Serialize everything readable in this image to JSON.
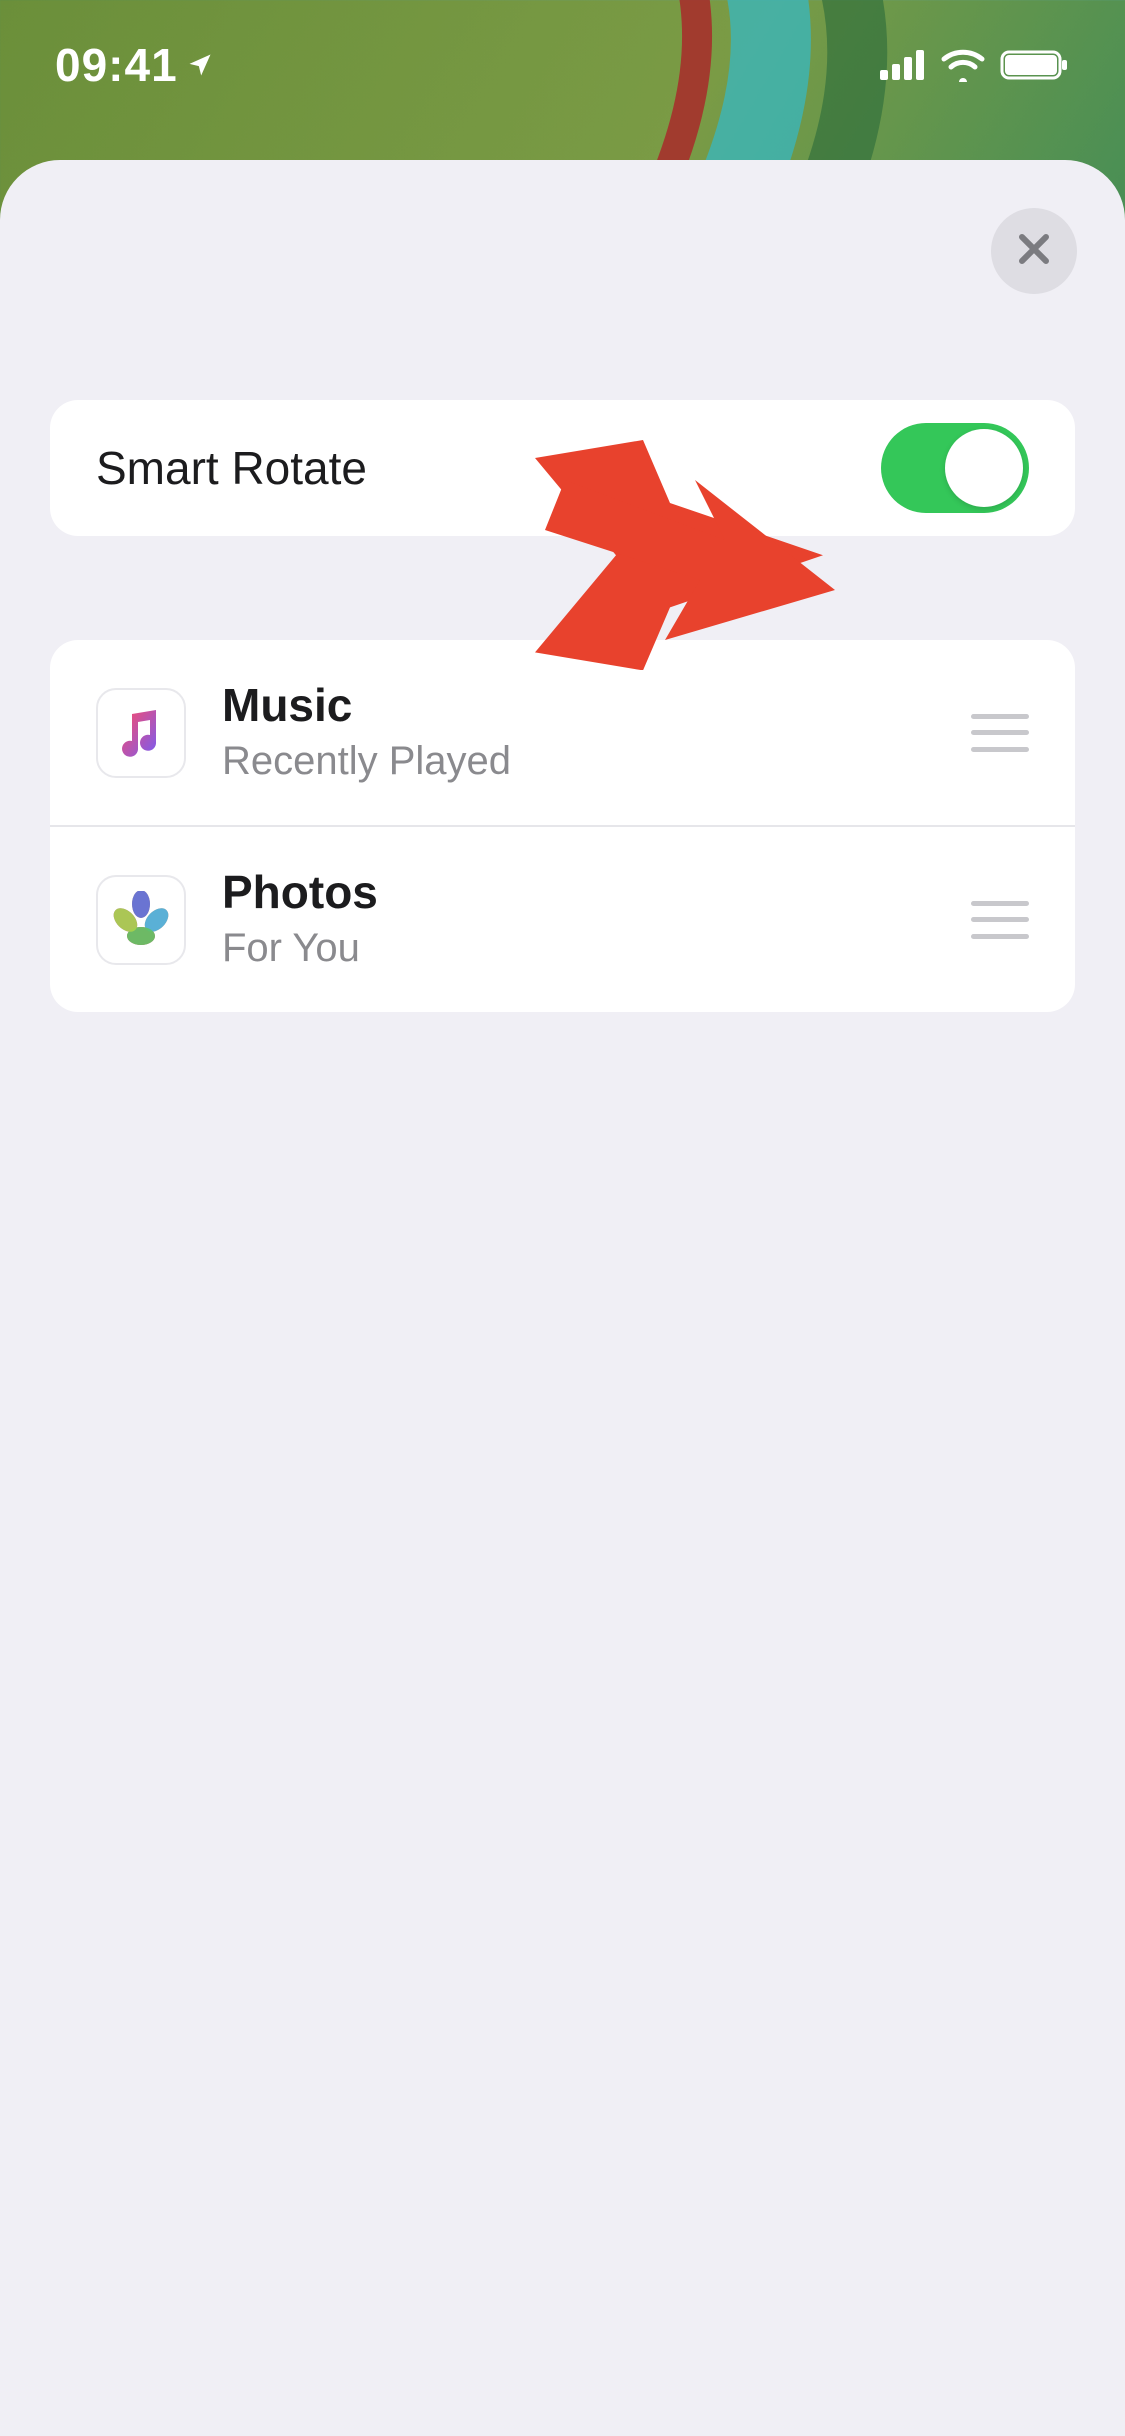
{
  "status": {
    "time": "09:41",
    "location_arrow": true
  },
  "sheet": {
    "close_label": "Close"
  },
  "smart_rotate": {
    "label": "Smart Rotate",
    "enabled": true
  },
  "widgets": [
    {
      "icon": "music-icon",
      "title": "Music",
      "subtitle": "Recently Played"
    },
    {
      "icon": "photos-icon",
      "title": "Photos",
      "subtitle": "For You"
    }
  ],
  "annotation": {
    "type": "arrow",
    "color": "#e8422d"
  },
  "colors": {
    "toggle_on": "#34c759",
    "sheet_bg": "#f0eff5",
    "arrow": "#e8422d"
  }
}
